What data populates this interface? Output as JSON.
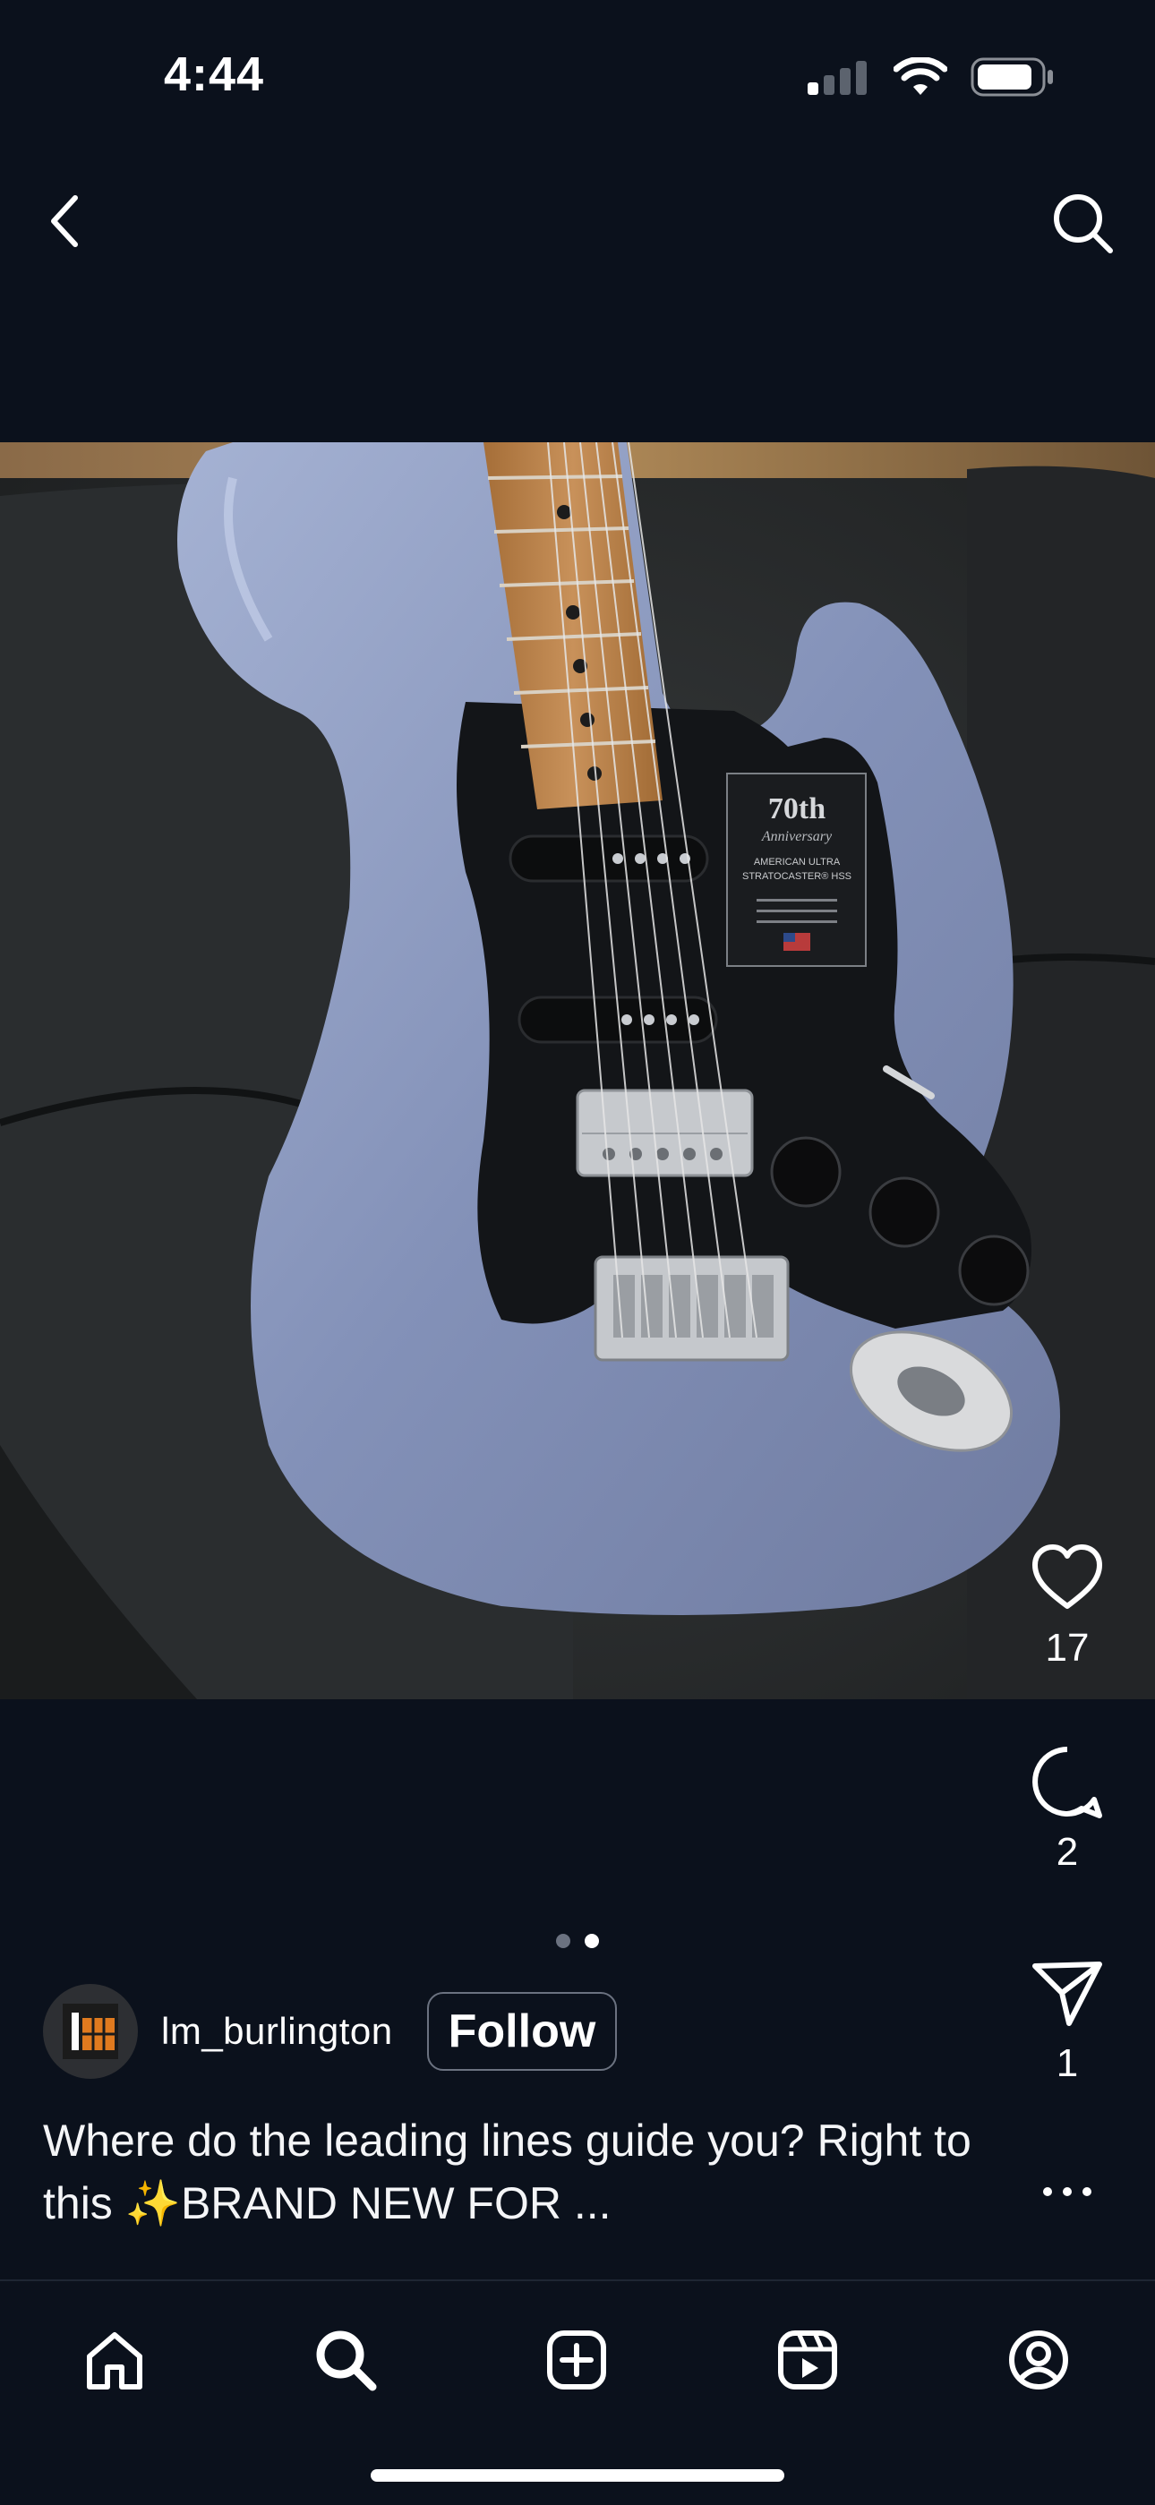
{
  "status_bar": {
    "time": "4:44"
  },
  "post": {
    "likes": "17",
    "comments": "2",
    "shares": "1",
    "author": "lm_burlington",
    "follow_label": "Follow",
    "caption": "Where do the leading lines guide you? Right to this ✨BRAND NEW FOR ...",
    "carousel": {
      "count": 2,
      "active_index": 1
    }
  },
  "photo": {
    "badge_title": "70th",
    "badge_subtitle": "Anniversary",
    "badge_model": "AMERICAN ULTRA STRATOCASTER® HSS"
  },
  "icons": [
    "chevron-left-icon",
    "search-icon",
    "heart-icon",
    "comment-icon",
    "send-icon",
    "more-icon",
    "home-icon",
    "explore-icon",
    "create-icon",
    "reels-icon",
    "profile-icon"
  ],
  "colors": {
    "background": "#0b111c",
    "guitar_blue": "#8b9ac0",
    "pickguard": "#121417",
    "fretboard": "#c08a4e"
  }
}
